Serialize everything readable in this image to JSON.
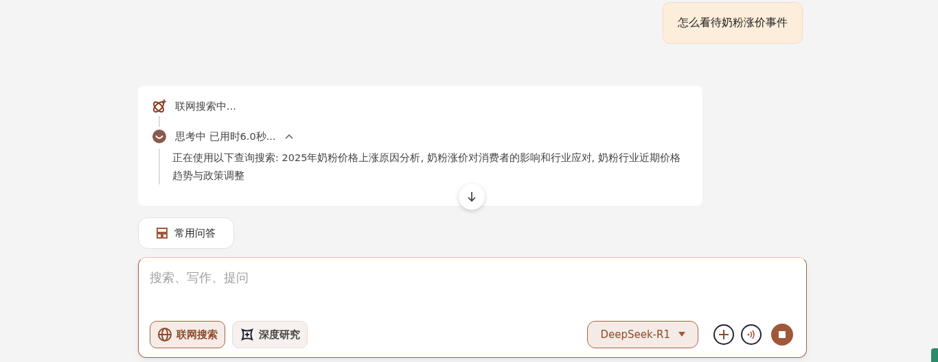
{
  "user_message": "怎么看待奶粉涨价事件",
  "answer": {
    "steps": [
      {
        "kind": "search",
        "label": "联网搜索中..."
      },
      {
        "kind": "thinking",
        "label": "思考中 已用时6.0秒...",
        "expanded": true,
        "detail": "正在使用以下查询搜索: 2025年奶粉价格上涨原因分析, 奶粉涨价对消费者的影响和行业应对, 奶粉行业近期价格趋势与政策调整"
      }
    ]
  },
  "quick_button": "常用问答",
  "composer": {
    "placeholder": "搜索、写作、提问",
    "toggles": [
      {
        "kind": "web",
        "label": "联网搜索",
        "selected": true
      },
      {
        "kind": "research",
        "label": "深度研究",
        "selected": false
      }
    ],
    "model": "DeepSeek-R1",
    "generating": true
  }
}
